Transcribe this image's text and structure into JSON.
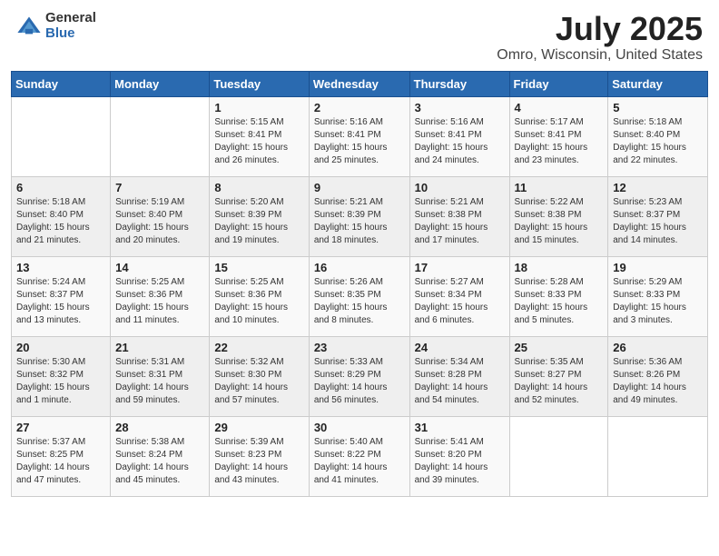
{
  "logo": {
    "general": "General",
    "blue": "Blue"
  },
  "title": "July 2025",
  "subtitle": "Omro, Wisconsin, United States",
  "days_of_week": [
    "Sunday",
    "Monday",
    "Tuesday",
    "Wednesday",
    "Thursday",
    "Friday",
    "Saturday"
  ],
  "weeks": [
    [
      {
        "day": "",
        "info": ""
      },
      {
        "day": "",
        "info": ""
      },
      {
        "day": "1",
        "info": "Sunrise: 5:15 AM\nSunset: 8:41 PM\nDaylight: 15 hours\nand 26 minutes."
      },
      {
        "day": "2",
        "info": "Sunrise: 5:16 AM\nSunset: 8:41 PM\nDaylight: 15 hours\nand 25 minutes."
      },
      {
        "day": "3",
        "info": "Sunrise: 5:16 AM\nSunset: 8:41 PM\nDaylight: 15 hours\nand 24 minutes."
      },
      {
        "day": "4",
        "info": "Sunrise: 5:17 AM\nSunset: 8:41 PM\nDaylight: 15 hours\nand 23 minutes."
      },
      {
        "day": "5",
        "info": "Sunrise: 5:18 AM\nSunset: 8:40 PM\nDaylight: 15 hours\nand 22 minutes."
      }
    ],
    [
      {
        "day": "6",
        "info": "Sunrise: 5:18 AM\nSunset: 8:40 PM\nDaylight: 15 hours\nand 21 minutes."
      },
      {
        "day": "7",
        "info": "Sunrise: 5:19 AM\nSunset: 8:40 PM\nDaylight: 15 hours\nand 20 minutes."
      },
      {
        "day": "8",
        "info": "Sunrise: 5:20 AM\nSunset: 8:39 PM\nDaylight: 15 hours\nand 19 minutes."
      },
      {
        "day": "9",
        "info": "Sunrise: 5:21 AM\nSunset: 8:39 PM\nDaylight: 15 hours\nand 18 minutes."
      },
      {
        "day": "10",
        "info": "Sunrise: 5:21 AM\nSunset: 8:38 PM\nDaylight: 15 hours\nand 17 minutes."
      },
      {
        "day": "11",
        "info": "Sunrise: 5:22 AM\nSunset: 8:38 PM\nDaylight: 15 hours\nand 15 minutes."
      },
      {
        "day": "12",
        "info": "Sunrise: 5:23 AM\nSunset: 8:37 PM\nDaylight: 15 hours\nand 14 minutes."
      }
    ],
    [
      {
        "day": "13",
        "info": "Sunrise: 5:24 AM\nSunset: 8:37 PM\nDaylight: 15 hours\nand 13 minutes."
      },
      {
        "day": "14",
        "info": "Sunrise: 5:25 AM\nSunset: 8:36 PM\nDaylight: 15 hours\nand 11 minutes."
      },
      {
        "day": "15",
        "info": "Sunrise: 5:25 AM\nSunset: 8:36 PM\nDaylight: 15 hours\nand 10 minutes."
      },
      {
        "day": "16",
        "info": "Sunrise: 5:26 AM\nSunset: 8:35 PM\nDaylight: 15 hours\nand 8 minutes."
      },
      {
        "day": "17",
        "info": "Sunrise: 5:27 AM\nSunset: 8:34 PM\nDaylight: 15 hours\nand 6 minutes."
      },
      {
        "day": "18",
        "info": "Sunrise: 5:28 AM\nSunset: 8:33 PM\nDaylight: 15 hours\nand 5 minutes."
      },
      {
        "day": "19",
        "info": "Sunrise: 5:29 AM\nSunset: 8:33 PM\nDaylight: 15 hours\nand 3 minutes."
      }
    ],
    [
      {
        "day": "20",
        "info": "Sunrise: 5:30 AM\nSunset: 8:32 PM\nDaylight: 15 hours\nand 1 minute."
      },
      {
        "day": "21",
        "info": "Sunrise: 5:31 AM\nSunset: 8:31 PM\nDaylight: 14 hours\nand 59 minutes."
      },
      {
        "day": "22",
        "info": "Sunrise: 5:32 AM\nSunset: 8:30 PM\nDaylight: 14 hours\nand 57 minutes."
      },
      {
        "day": "23",
        "info": "Sunrise: 5:33 AM\nSunset: 8:29 PM\nDaylight: 14 hours\nand 56 minutes."
      },
      {
        "day": "24",
        "info": "Sunrise: 5:34 AM\nSunset: 8:28 PM\nDaylight: 14 hours\nand 54 minutes."
      },
      {
        "day": "25",
        "info": "Sunrise: 5:35 AM\nSunset: 8:27 PM\nDaylight: 14 hours\nand 52 minutes."
      },
      {
        "day": "26",
        "info": "Sunrise: 5:36 AM\nSunset: 8:26 PM\nDaylight: 14 hours\nand 49 minutes."
      }
    ],
    [
      {
        "day": "27",
        "info": "Sunrise: 5:37 AM\nSunset: 8:25 PM\nDaylight: 14 hours\nand 47 minutes."
      },
      {
        "day": "28",
        "info": "Sunrise: 5:38 AM\nSunset: 8:24 PM\nDaylight: 14 hours\nand 45 minutes."
      },
      {
        "day": "29",
        "info": "Sunrise: 5:39 AM\nSunset: 8:23 PM\nDaylight: 14 hours\nand 43 minutes."
      },
      {
        "day": "30",
        "info": "Sunrise: 5:40 AM\nSunset: 8:22 PM\nDaylight: 14 hours\nand 41 minutes."
      },
      {
        "day": "31",
        "info": "Sunrise: 5:41 AM\nSunset: 8:20 PM\nDaylight: 14 hours\nand 39 minutes."
      },
      {
        "day": "",
        "info": ""
      },
      {
        "day": "",
        "info": ""
      }
    ]
  ]
}
